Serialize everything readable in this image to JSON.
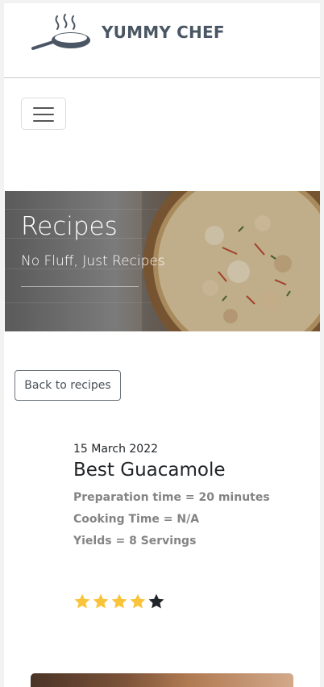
{
  "brand": {
    "name": "YUMMY CHEF",
    "logo_icon": "frying-pan-icon"
  },
  "nav": {
    "toggler_icon": "hamburger-icon"
  },
  "hero": {
    "title": "Recipes",
    "subtitle": "No Fluff, Just Recipes"
  },
  "back_button": {
    "label": "Back to recipes"
  },
  "recipe": {
    "date": "15 March 2022",
    "title": "Best Guacamole",
    "prep": "Preparation time = 20 minutes",
    "cook": "Cooking Time = N/A",
    "yields": "Yields = 8 Servings",
    "rating": 4,
    "rating_max": 5
  },
  "colors": {
    "star_filled": "#f9c33a",
    "star_empty": "#212529",
    "brand_text": "#4a5663"
  }
}
